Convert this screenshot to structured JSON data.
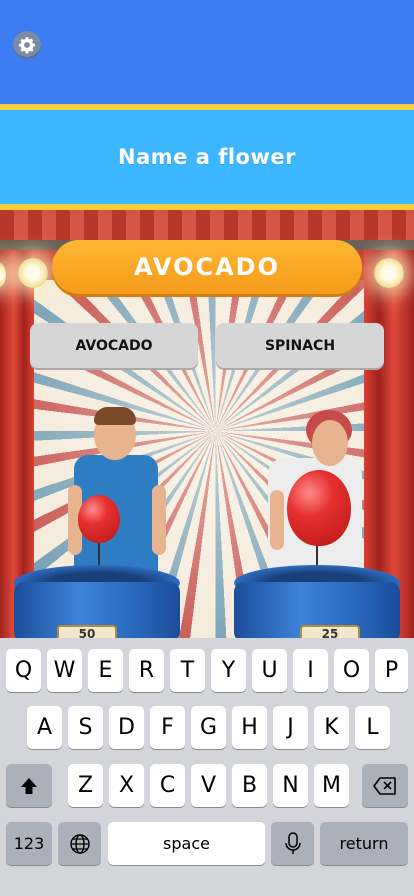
{
  "header": {
    "settings_icon": "gear-icon"
  },
  "question": {
    "text": "Name a flower"
  },
  "answer": {
    "text": "AVOCADO"
  },
  "choices": [
    {
      "label": "AVOCADO"
    },
    {
      "label": "SPINACH"
    }
  ],
  "scores": {
    "left": "50",
    "right": "25"
  },
  "keyboard": {
    "row1": [
      "Q",
      "W",
      "E",
      "R",
      "T",
      "Y",
      "U",
      "I",
      "O",
      "P"
    ],
    "row2": [
      "A",
      "S",
      "D",
      "F",
      "G",
      "H",
      "J",
      "K",
      "L"
    ],
    "row3": [
      "Z",
      "X",
      "C",
      "V",
      "B",
      "N",
      "M"
    ],
    "numbers_label": "123",
    "space_label": "space",
    "return_label": "return"
  }
}
